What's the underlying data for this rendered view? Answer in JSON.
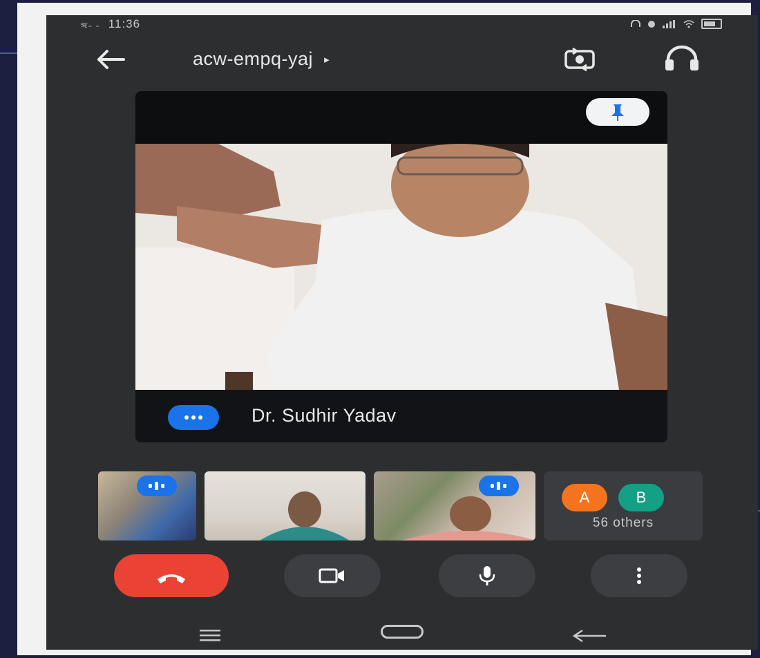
{
  "status_bar": {
    "signal_text": "ऋ₌ ₌",
    "time": "11:36",
    "right_icons": [
      "headset-icon",
      "alarm-icon",
      "signal-icon",
      "wifi-icon",
      "battery-icon"
    ]
  },
  "app_bar": {
    "meeting_code": "acw-empq-yaj",
    "caret": "▸",
    "icons": [
      "back-arrow-icon",
      "switch-camera-icon",
      "headphones-icon"
    ]
  },
  "main_tile": {
    "speaker_name": "Dr. Sudhir Yadav",
    "pin_icon": "pin-icon",
    "speaking_indicator": "speaking-icon"
  },
  "thumbnails": {
    "others_avatars": [
      "A",
      "B"
    ],
    "others_label": "56 others"
  },
  "controls": {
    "icons": [
      "end-call-icon",
      "camera-icon",
      "microphone-icon",
      "more-vert-icon"
    ],
    "colors": {
      "end_call": "#ea4335",
      "control_bg": "#3c3e41",
      "speaking": "#1a73e8"
    }
  },
  "nav_bar": {
    "icons": [
      "menu-icon",
      "home-icon",
      "nav-back-icon"
    ]
  },
  "colors": {
    "slide_background": "#1c1f3f",
    "app_background": "#2c2e30",
    "avatar_a": "#f4731f",
    "avatar_b": "#13a085"
  }
}
